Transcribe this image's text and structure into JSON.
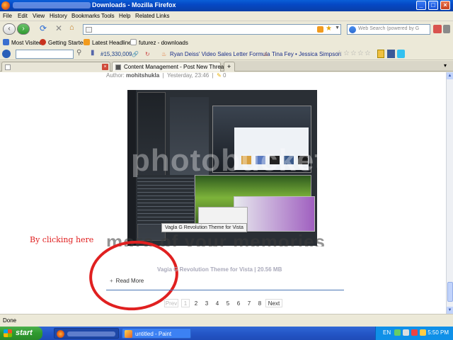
{
  "window": {
    "title": "Downloads - Mozilla Firefox",
    "min_label": "_",
    "max_label": "□",
    "close_label": "×"
  },
  "menu": {
    "items": [
      "File",
      "Edit",
      "View",
      "History",
      "Bookmarks",
      "Tools",
      "Help",
      "Related Links"
    ]
  },
  "nav": {
    "url": "",
    "search_placeholder": "Web Search (powered by G"
  },
  "bookmarks": {
    "items": [
      "Most Visited",
      "Getting Started",
      "Latest Headlines",
      "futurez - downloads"
    ]
  },
  "extra_toolbar": {
    "counter": "#15,330,009",
    "link1": "Ryan Deiss' Video Sales Letter Formula",
    "link2": "Tina Fey • Jessica Simpson"
  },
  "tabs": [
    {
      "label": "",
      "active": false
    },
    {
      "label": "Content Management - Post New Thread",
      "active": true
    }
  ],
  "post": {
    "author_prefix": "Author:",
    "author": "mohitshukla",
    "date": "Yesterday, 23:46",
    "comments": "0",
    "screenshot_caption": "Vagla G Revolution Theme for Vista",
    "watermark": "photobucket",
    "motto": "more of your memories",
    "file_caption": "Vagia G Revolution Theme for Vista | 20.56 MB",
    "read_more": "Read More"
  },
  "annotation": {
    "text": "By clicking here",
    "color": "#e02020"
  },
  "pagination": {
    "prev": "Prev",
    "pages": [
      "1",
      "2",
      "3",
      "4",
      "5",
      "6",
      "7",
      "8"
    ],
    "next": "Next",
    "current": "1"
  },
  "status": {
    "text": "Done"
  },
  "taskbar": {
    "start": "start",
    "tasks": [
      {
        "label": "",
        "icon": "firefox-icon"
      },
      {
        "label": "untitled - Paint",
        "icon": "paint-icon"
      }
    ],
    "language": "EN",
    "clock": "5:50 PM"
  }
}
